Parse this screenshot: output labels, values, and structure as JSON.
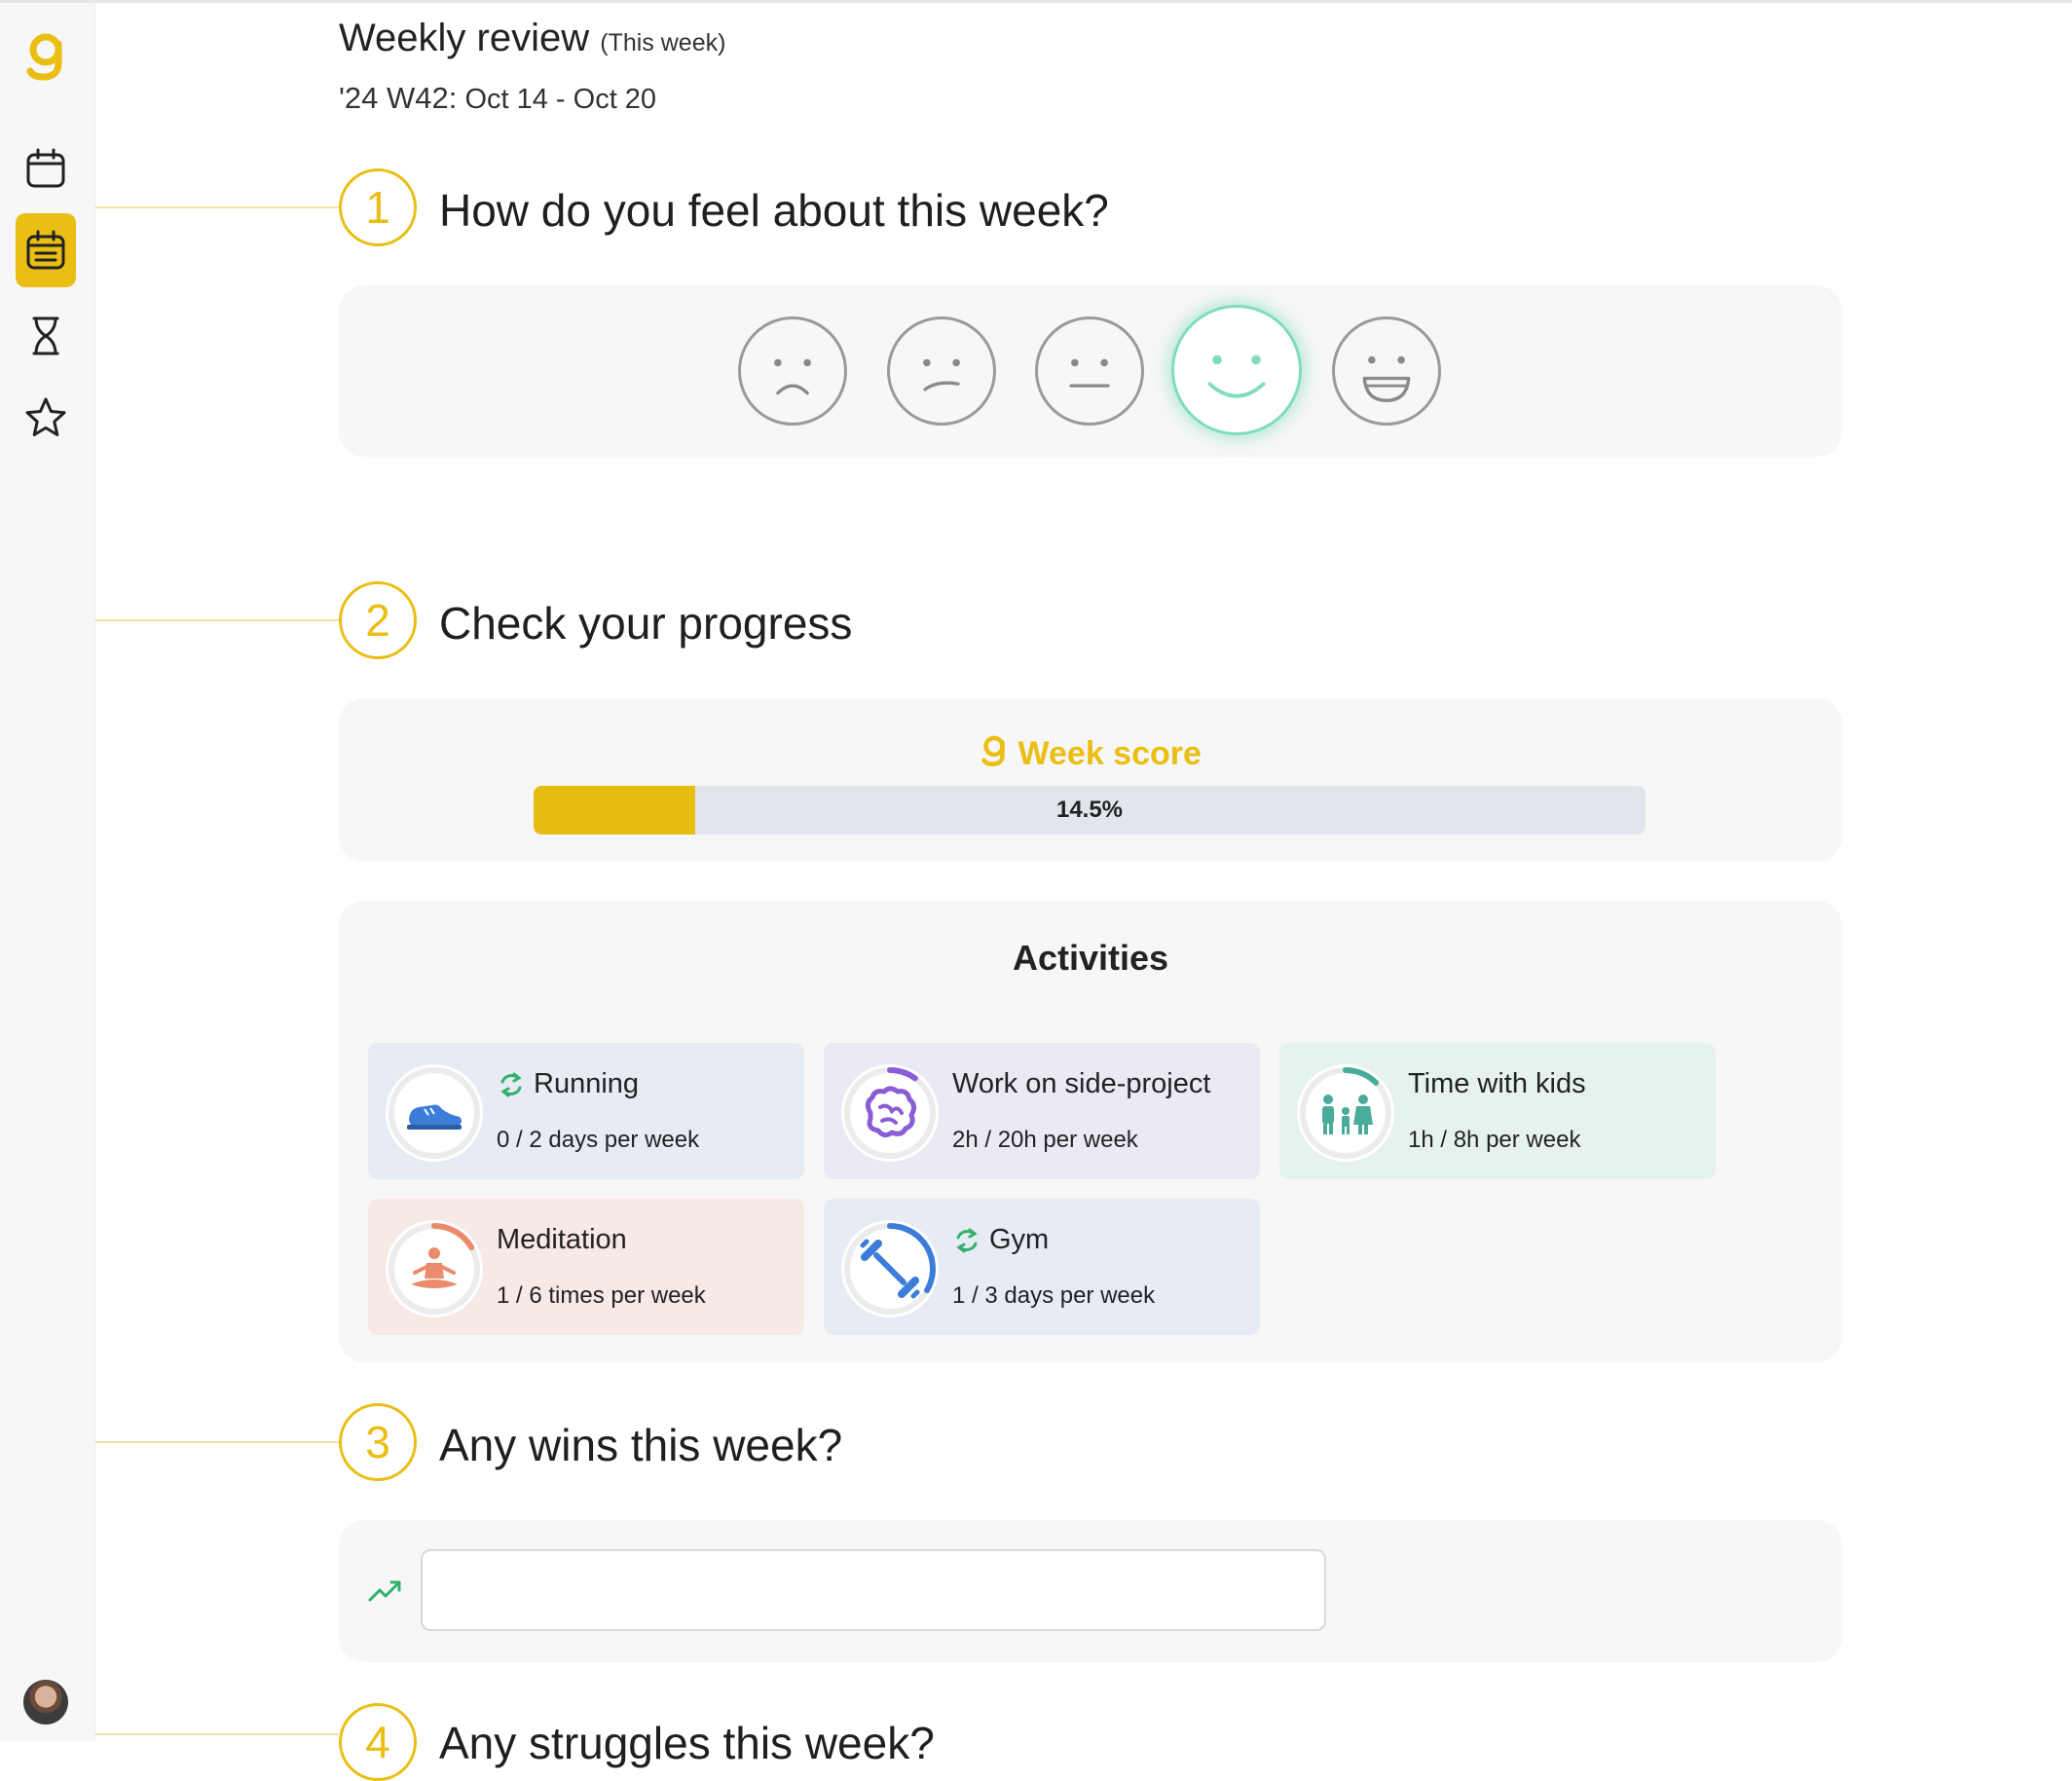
{
  "app": {
    "logo_icon": "gooals-logo-icon"
  },
  "sidebar": {
    "items": [
      {
        "id": "calendar",
        "icon": "calendar-icon",
        "active": false
      },
      {
        "id": "weekly-review",
        "icon": "calendar-list-icon",
        "active": true
      },
      {
        "id": "timer",
        "icon": "hourglass-icon",
        "active": false
      },
      {
        "id": "favorites",
        "icon": "star-icon",
        "active": false
      }
    ],
    "avatar_icon": "user-avatar"
  },
  "header": {
    "title": "Weekly review",
    "title_note": "(This week)",
    "week_code": "'24 W42:",
    "date_range": "Oct 14 - Oct 20"
  },
  "steps": [
    {
      "number": "1",
      "title": "How do you feel about this week?"
    },
    {
      "number": "2",
      "title": "Check your progress"
    },
    {
      "number": "3",
      "title": "Any wins this week?"
    },
    {
      "number": "4",
      "title": "Any struggles this week?"
    }
  ],
  "moods": {
    "options": [
      "very-sad-face-icon",
      "sad-face-icon",
      "neutral-face-icon",
      "smile-face-icon",
      "grin-face-icon"
    ],
    "selected_index": 3,
    "selected_color": "#7fdcc0"
  },
  "week_score": {
    "label": "Week score",
    "value_text": "14.5%",
    "value": 14.5,
    "color": "#eabe13"
  },
  "activities": {
    "title": "Activities",
    "items": [
      {
        "name": "Running",
        "goal": "0 / 2 days per week",
        "recurring": true,
        "icon": "sneaker-icon",
        "progress": 0,
        "bg": "#e6ebf4",
        "accent": "#3b7dd8"
      },
      {
        "name": "Work on side-project",
        "goal": "2h / 20h per week",
        "recurring": false,
        "icon": "brain-icon",
        "progress": 0.1,
        "bg": "#ece8f4",
        "accent": "#8a5cd6"
      },
      {
        "name": "Time with kids",
        "goal": "1h / 8h per week",
        "recurring": false,
        "icon": "family-icon",
        "progress": 0.125,
        "bg": "#e6f2ef",
        "accent": "#4aab9a"
      },
      {
        "name": "Meditation",
        "goal": "1 / 6 times per week",
        "recurring": false,
        "icon": "meditation-icon",
        "progress": 0.1667,
        "bg": "#f6e9e6",
        "accent": "#ec8a6c"
      },
      {
        "name": "Gym",
        "goal": "1 / 3 days per week",
        "recurring": true,
        "icon": "dumbbell-icon",
        "progress": 0.3333,
        "bg": "#e6ebf4",
        "accent": "#3b7dd8"
      }
    ]
  },
  "wins": {
    "icon": "trending-up-icon",
    "value": "",
    "placeholder": ""
  }
}
